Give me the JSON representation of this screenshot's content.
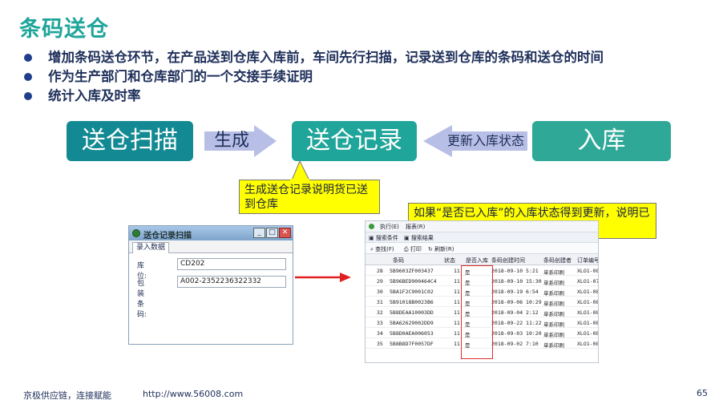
{
  "title": "条码送仓",
  "bullets": [
    "增加条码送仓环节，在产品送到仓库入库前，车间先行扫描，记录送到仓库的条码和送仓的时间",
    "作为生产部门和仓库部门的一个交接手续证明",
    "统计入库及时率"
  ],
  "flow": {
    "scan": "送仓扫描",
    "generate": "生成",
    "record": "送仓记录",
    "update": "更新入库状态",
    "stock": "入库"
  },
  "callouts": {
    "record_note": "生成送仓记录说明货已送到仓库",
    "status_note": "如果“是否已入库”的入库状态得到更新，说明已入库，否则还未入库"
  },
  "scan_window": {
    "title": "送仓记录扫描",
    "tab": "录入数据",
    "location_label": "库位:",
    "location_value": "CD202",
    "barcode_label": "包装条码:",
    "barcode_value": "A002-2352236322332"
  },
  "record_window": {
    "menu": [
      "执行(E)",
      "报表(R)"
    ],
    "tabs": [
      "搜索条件",
      "搜索结果"
    ],
    "toolbar": [
      "查找(F)",
      "打印",
      "刷新(R)"
    ],
    "columns": [
      "",
      "条码",
      "状态",
      "是否入库",
      "条码创建时间",
      "条码创建者",
      "订单编号"
    ],
    "rows": [
      [
        "28",
        "5B9603ZF003437",
        "11",
        "是",
        "2018-09-10 5:21",
        "单系印刷",
        "XLO1-08-"
      ],
      [
        "29",
        "5B96BED900464C4",
        "11",
        "是",
        "2018-09-10 15:30",
        "单系印刷",
        "XLO1-07-"
      ],
      [
        "30",
        "5BA1F2C9001C02",
        "11",
        "是",
        "2018-09-19 6:54",
        "单系印刷",
        "XLO1-08-"
      ],
      [
        "31",
        "5B91018B0023B6",
        "11",
        "是",
        "2018-09-06 10:29",
        "单系印刷",
        "XLO1-08-"
      ],
      [
        "32",
        "5B8DEAA10003DD",
        "11",
        "是",
        "2018-09-04 2:12",
        "单系印刷",
        "XLO1-08-"
      ],
      [
        "33",
        "5BA62629002DD9",
        "11",
        "是",
        "2018-09-22 11:22",
        "单系印刷",
        "XLO1-08-"
      ],
      [
        "34",
        "5B8D0AEA006053",
        "11",
        "是",
        "2018-09-03 10:20",
        "单系印刷",
        "XLO1-08-"
      ],
      [
        "35",
        "5B8B8D7F0057DF",
        "11",
        "是",
        "2018-09-02 7:10",
        "单系印刷",
        "XLO1-08-"
      ]
    ]
  },
  "footer": {
    "tagline": "京极供应链，连接赋能",
    "url": "http://www.56008.com",
    "page": "65"
  },
  "colors": {
    "title": "#1fa59a",
    "box_scan": "#138a93",
    "box_record": "#1fa59a",
    "box_stock": "#2fa898",
    "arrow": "#b8bfe6",
    "callout": "#ffff00",
    "highlight": "#e03030"
  }
}
